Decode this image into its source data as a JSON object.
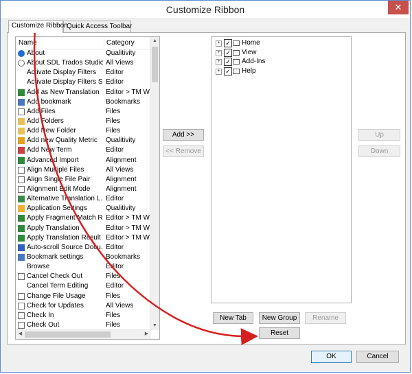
{
  "window": {
    "title": "Customize Ribbon",
    "close_label": "✕"
  },
  "tabs": [
    {
      "label": "Customize Ribbon",
      "active": true
    },
    {
      "label": "Quick Access Toolbar",
      "active": false
    }
  ],
  "commands": {
    "columns": {
      "name": "Name",
      "category": "Category"
    },
    "rows": [
      {
        "name": "About",
        "category": "Qualitivity",
        "icon": "info-icon"
      },
      {
        "name": "About SDL Trados Studio",
        "category": "All Views",
        "icon": "info-circle-icon"
      },
      {
        "name": "Activate Display Filters",
        "category": "Editor",
        "icon": "none"
      },
      {
        "name": "Activate Display Filters S...",
        "category": "Editor",
        "icon": "none"
      },
      {
        "name": "Add as New Translation",
        "category": "Editor > TM Wi",
        "icon": "tm-add-icon"
      },
      {
        "name": "Add bookmark",
        "category": "Bookmarks",
        "icon": "bookmark-icon"
      },
      {
        "name": "Add Files",
        "category": "Files",
        "icon": "add-file-icon"
      },
      {
        "name": "Add Folders",
        "category": "Files",
        "icon": "add-folder-icon"
      },
      {
        "name": "Add New Folder",
        "category": "Files",
        "icon": "new-folder-icon"
      },
      {
        "name": "Add new Quality Metric",
        "category": "Qualitivity",
        "icon": "quality-metric-icon"
      },
      {
        "name": "Add New Term",
        "category": "Editor",
        "icon": "term-icon"
      },
      {
        "name": "Advanced Import",
        "category": "Alignment",
        "icon": "import-icon"
      },
      {
        "name": "Align Multiple Files",
        "category": "All Views",
        "icon": "align-icon"
      },
      {
        "name": "Align Single File Pair",
        "category": "Alignment",
        "icon": "align-icon"
      },
      {
        "name": "Alignment Edit Mode",
        "category": "Alignment",
        "icon": "align-icon"
      },
      {
        "name": "Alternative Translation L...",
        "category": "Editor",
        "icon": "translation-icon"
      },
      {
        "name": "Application Settings",
        "category": "Qualitivity",
        "icon": "settings-icon"
      },
      {
        "name": "Apply Fragment Match Re...",
        "category": "Editor > TM Wi",
        "icon": "fragment-icon"
      },
      {
        "name": "Apply Translation",
        "category": "Editor > TM Wi",
        "icon": "tm-apply-icon"
      },
      {
        "name": "Apply Translation Result",
        "category": "Editor > TM Wi",
        "icon": "tm-apply-icon"
      },
      {
        "name": "Auto-scroll Source Docu...",
        "category": "Editor",
        "icon": "autoscroll-icon"
      },
      {
        "name": "Bookmark settings",
        "category": "Bookmarks",
        "icon": "bookmark-settings-icon"
      },
      {
        "name": "Browse",
        "category": "Editor",
        "icon": "none"
      },
      {
        "name": "Cancel Check Out",
        "category": "Files",
        "icon": "cancel-checkout-icon"
      },
      {
        "name": "Cancel Term Editing",
        "category": "Editor",
        "icon": "none"
      },
      {
        "name": "Change File Usage",
        "category": "Files",
        "icon": "file-usage-icon"
      },
      {
        "name": "Check for Updates",
        "category": "All Views",
        "icon": "update-icon"
      },
      {
        "name": "Check In",
        "category": "Files",
        "icon": "check-in-icon"
      },
      {
        "name": "Check Out",
        "category": "Files",
        "icon": "check-out-icon"
      }
    ],
    "scroll_up": "▲",
    "scroll_down": "▼",
    "scroll_left": "◀",
    "scroll_right": "▶"
  },
  "buttons": {
    "add": "Add >>",
    "remove": "<< Remove",
    "up": "Up",
    "down": "Down",
    "new_tab": "New Tab",
    "new_group": "New Group",
    "rename": "Rename",
    "reset": "Reset",
    "ok": "OK",
    "cancel": "Cancel"
  },
  "ribbon_tree": [
    {
      "label": "Home",
      "checked": true,
      "expand": "+",
      "check_glyph": "✓"
    },
    {
      "label": "View",
      "checked": true,
      "expand": "+",
      "check_glyph": "✓"
    },
    {
      "label": "Add-Ins",
      "checked": true,
      "expand": "+",
      "check_glyph": "✓"
    },
    {
      "label": "Help",
      "checked": true,
      "expand": "+",
      "check_glyph": "✓"
    }
  ],
  "colors": {
    "annotation_arrow": "#d71f1f",
    "accent": "#3c7fb1"
  }
}
